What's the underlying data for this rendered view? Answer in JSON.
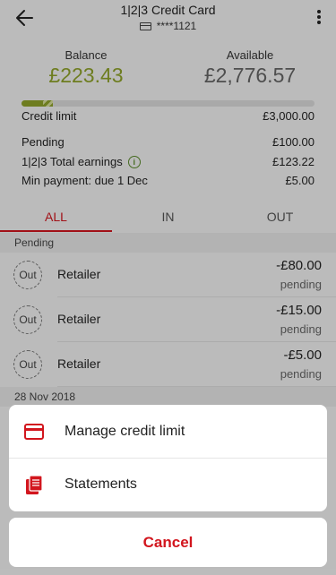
{
  "header": {
    "title": "1|2|3 Credit Card",
    "card_number": "****1121",
    "back_icon": "arrow-left-icon",
    "more_icon": "more-vertical-icon"
  },
  "summary": {
    "balance_label": "Balance",
    "balance_value": "£223.43",
    "available_label": "Available",
    "available_value": "£2,776.57",
    "usage": {
      "used_fraction": 0.074,
      "pending_fraction": 0.033
    },
    "rows": [
      {
        "label": "Credit limit",
        "value": "£3,000.00"
      },
      {
        "label": "Pending",
        "value": "£100.00"
      },
      {
        "label": "1|2|3 Total earnings",
        "value": "£123.22"
      },
      {
        "label": "Min payment: due 1 Dec",
        "value": "£5.00"
      }
    ]
  },
  "tabs": [
    {
      "label": "ALL",
      "active": true
    },
    {
      "label": "IN",
      "active": false
    },
    {
      "label": "OUT",
      "active": false
    }
  ],
  "sections": [
    {
      "heading": "Pending",
      "transactions": [
        {
          "badge": "Out",
          "name": "Retailer",
          "amount": "-£80.00",
          "status": "pending"
        },
        {
          "badge": "Out",
          "name": "Retailer",
          "amount": "-£15.00",
          "status": "pending"
        },
        {
          "badge": "Out",
          "name": "Retailer",
          "amount": "-£5.00",
          "status": "pending"
        }
      ]
    },
    {
      "heading": "28 Nov 2018"
    }
  ],
  "action_sheet": {
    "items": [
      {
        "label": "Manage credit limit",
        "icon": "credit-card-icon"
      },
      {
        "label": "Statements",
        "icon": "statements-icon"
      }
    ],
    "cancel_label": "Cancel"
  },
  "colors": {
    "accent_red": "#d2161e",
    "balance_green": "#8fa32a"
  }
}
